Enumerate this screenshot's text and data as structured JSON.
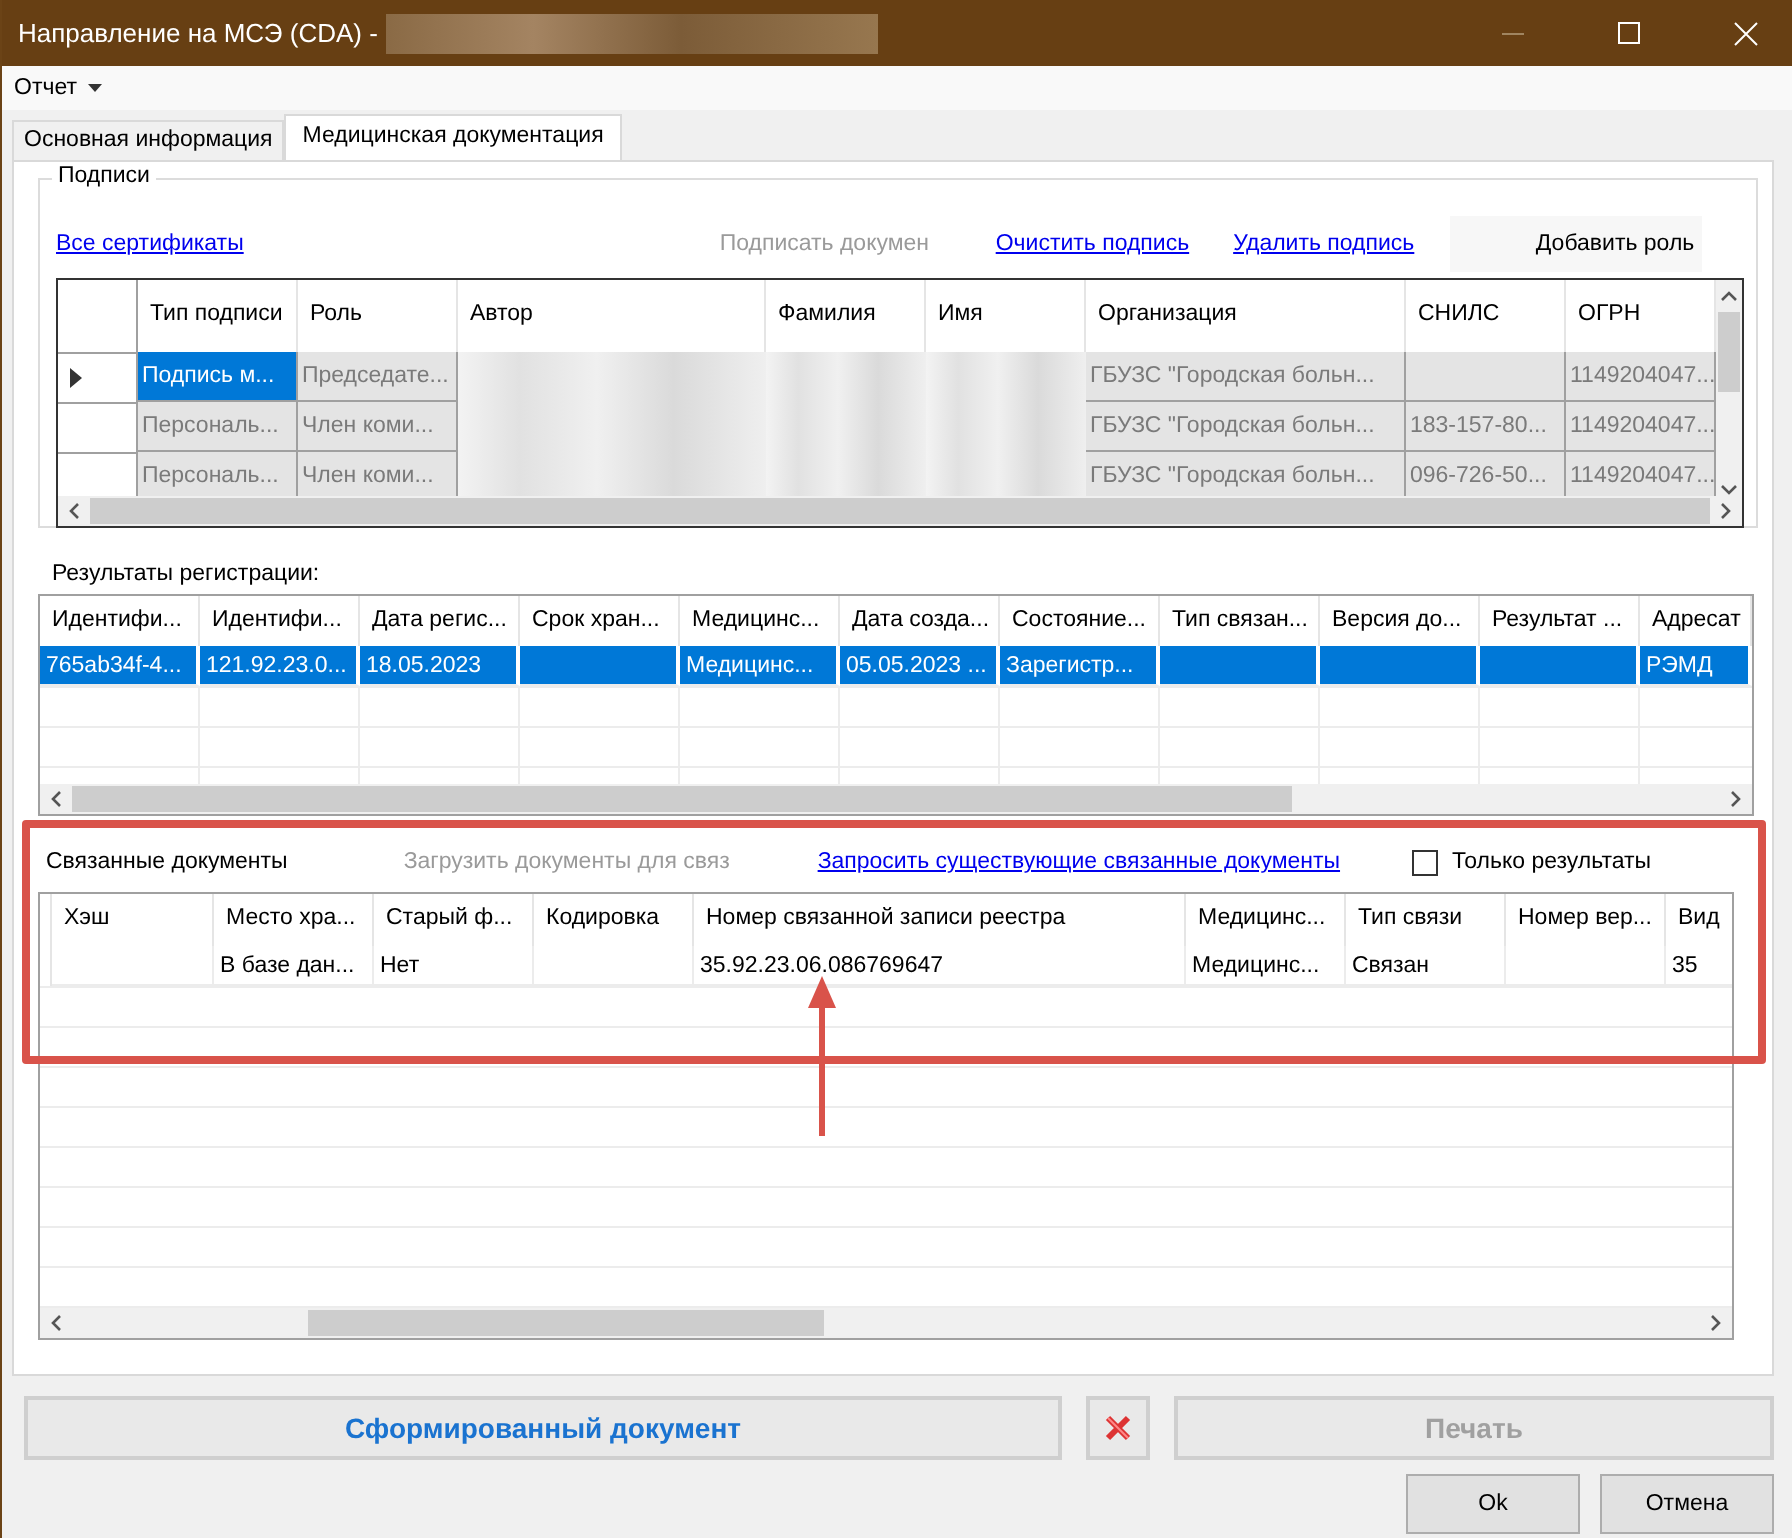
{
  "window": {
    "title": "Направление на МСЭ (CDA) -"
  },
  "menu": [
    {
      "label": "Отчет"
    }
  ],
  "tabs": [
    {
      "label": "Основная информация",
      "selected": false
    },
    {
      "label": "Медицинская документация",
      "selected": true
    }
  ],
  "signatures": {
    "title": "Подписи",
    "actions": [
      {
        "kind": "link",
        "label": "Все сертификаты"
      },
      {
        "kind": "disabled",
        "label": "Подписать докумен"
      },
      {
        "kind": "link",
        "label": "Очистить подпись"
      },
      {
        "kind": "link",
        "label": "Удалить подпись"
      },
      {
        "kind": "button",
        "label": "Добавить роль"
      }
    ],
    "columns": [
      "Тип подписи",
      "Роль",
      "Автор",
      "Фамилия",
      "Имя",
      "Организация",
      "СНИЛС",
      "ОГРН"
    ],
    "rows": [
      {
        "selected": true,
        "cells": [
          {
            "kind": "text",
            "text": "Подпись м..."
          },
          {
            "kind": "text",
            "text": "Председате..."
          },
          {
            "kind": "blurred"
          },
          {
            "kind": "blurred"
          },
          {
            "kind": "blurred"
          },
          {
            "kind": "text",
            "text": "ГБУЗС \"Городская больн..."
          },
          {
            "kind": "empty"
          },
          {
            "kind": "text",
            "text": "1149204047..."
          }
        ]
      },
      {
        "selected": false,
        "cells": [
          {
            "kind": "text",
            "text": "Персональ..."
          },
          {
            "kind": "text",
            "text": "Член коми..."
          },
          {
            "kind": "blurred"
          },
          {
            "kind": "blurred"
          },
          {
            "kind": "blurred"
          },
          {
            "kind": "text",
            "text": "ГБУЗС \"Городская больн..."
          },
          {
            "kind": "text",
            "text": "183-157-80..."
          },
          {
            "kind": "text",
            "text": "1149204047..."
          }
        ]
      },
      {
        "selected": false,
        "cells": [
          {
            "kind": "text",
            "text": "Персональ..."
          },
          {
            "kind": "text",
            "text": "Член коми..."
          },
          {
            "kind": "blurred"
          },
          {
            "kind": "blurred"
          },
          {
            "kind": "blurred"
          },
          {
            "kind": "text",
            "text": "ГБУЗС \"Городская больн..."
          },
          {
            "kind": "text",
            "text": "096-726-50..."
          },
          {
            "kind": "text",
            "text": "1149204047..."
          }
        ]
      }
    ]
  },
  "registration": {
    "title": "Результаты регистрации:",
    "columns": [
      "Идентифи...",
      "Идентифи...",
      "Дата регис...",
      "Срок хран...",
      "Медицинс...",
      "Дата созда...",
      "Состояние...",
      "Тип связан...",
      "Версия до...",
      "Результат ...",
      "Адресат"
    ],
    "rows": [
      {
        "selected": true,
        "cells": [
          {
            "kind": "text",
            "text": "765ab34f-4..."
          },
          {
            "kind": "text",
            "text": "121.92.23.0..."
          },
          {
            "kind": "text",
            "text": "18.05.2023"
          },
          {
            "kind": "empty"
          },
          {
            "kind": "text",
            "text": "Медицинс..."
          },
          {
            "kind": "text",
            "text": "05.05.2023 ..."
          },
          {
            "kind": "text",
            "text": "Зарегистр..."
          },
          {
            "kind": "empty"
          },
          {
            "kind": "empty"
          },
          {
            "kind": "empty"
          },
          {
            "kind": "text",
            "text": "РЭМД"
          }
        ]
      }
    ]
  },
  "linked": {
    "title": "Связанные документы",
    "actions": [
      {
        "kind": "disabled",
        "label": "Загрузить документы для связ"
      },
      {
        "kind": "link",
        "label": "Запросить существующие связанные документы"
      }
    ],
    "only_results": {
      "label": "Только результаты",
      "checked": false
    },
    "columns": [
      "Хэш",
      "Место хра...",
      "Старый ф...",
      "Кодировка",
      "Номер связанной записи реестра",
      "Медицинс...",
      "Тип связи",
      "Номер вер...",
      "Вид"
    ],
    "rows": [
      {
        "selected": false,
        "cells": [
          {
            "kind": "empty"
          },
          {
            "kind": "text",
            "text": "В базе дан..."
          },
          {
            "kind": "text",
            "text": "Нет"
          },
          {
            "kind": "empty"
          },
          {
            "kind": "text",
            "text": "35.92.23.06.086769647"
          },
          {
            "kind": "text",
            "text": "Медицинс..."
          },
          {
            "kind": "text",
            "text": "Связан"
          },
          {
            "kind": "empty"
          },
          {
            "kind": "text",
            "text": "35"
          }
        ]
      }
    ]
  },
  "footer": {
    "buttons": [
      {
        "kind": "primary",
        "label": "Сформированный документ"
      },
      {
        "kind": "icon"
      },
      {
        "kind": "disabled",
        "label": "Печать"
      }
    ],
    "dialog_buttons": [
      "Ok",
      "Отмена"
    ]
  }
}
